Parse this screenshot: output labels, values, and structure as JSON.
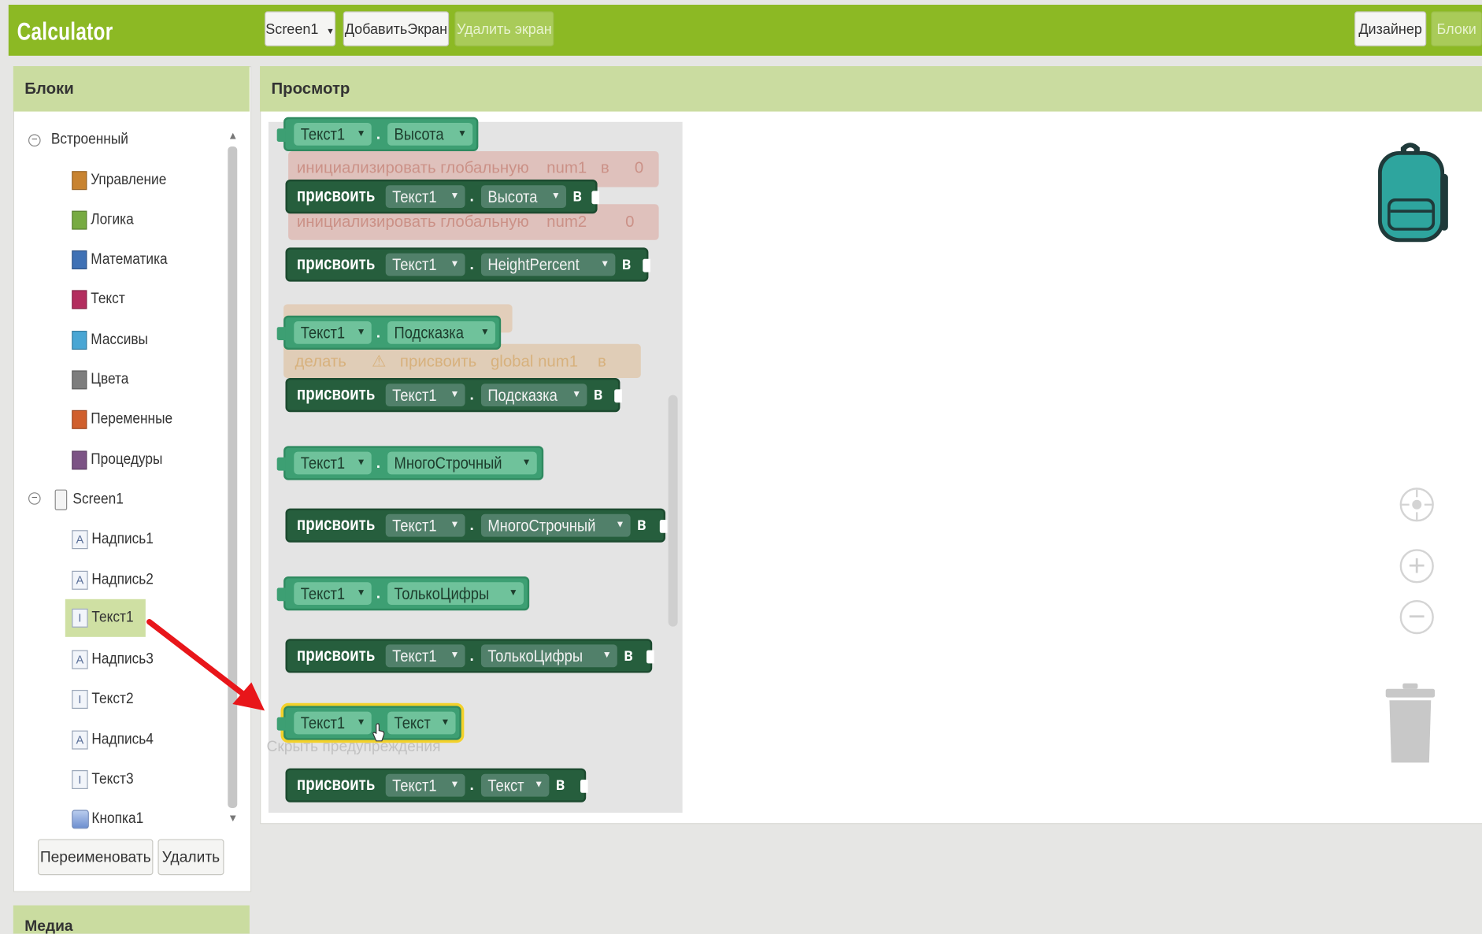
{
  "app": {
    "title": "Calculator"
  },
  "toolbar": {
    "screen_select": "Screen1",
    "add_screen": "ДобавитьЭкран",
    "remove_screen": "Удалить экран",
    "designer": "Дизайнер",
    "blocks": "Блоки"
  },
  "blocks_panel": {
    "header": "Блоки",
    "builtin_label": "Встроенный",
    "builtin_items": [
      {
        "label": "Управление",
        "color": "#c88330"
      },
      {
        "label": "Логика",
        "color": "#77ab41"
      },
      {
        "label": "Математика",
        "color": "#3f71b5"
      },
      {
        "label": "Текст",
        "color": "#b32d5e"
      },
      {
        "label": "Массивы",
        "color": "#49a6d4"
      },
      {
        "label": "Цвета",
        "color": "#7d7d7d"
      },
      {
        "label": "Переменные",
        "color": "#d05f2d"
      },
      {
        "label": "Процедуры",
        "color": "#7c5385"
      }
    ],
    "screen_label": "Screen1",
    "components": [
      {
        "label": "Надпись1",
        "icon": "label-icon"
      },
      {
        "label": "Надпись2",
        "icon": "label-icon"
      },
      {
        "label": "Текст1",
        "icon": "textbox-icon",
        "selected": true
      },
      {
        "label": "Надпись3",
        "icon": "label-icon"
      },
      {
        "label": "Текст2",
        "icon": "textbox-icon"
      },
      {
        "label": "Надпись4",
        "icon": "label-icon"
      },
      {
        "label": "Текст3",
        "icon": "textbox-icon"
      },
      {
        "label": "Кнопка1",
        "icon": "button-icon"
      }
    ],
    "rename_button": "Переименовать",
    "delete_button": "Удалить"
  },
  "media": {
    "header": "Медиа"
  },
  "viewer": {
    "header": "Просмотр"
  },
  "blocks_flyout": {
    "component": "Текст1",
    "set_keyword": "присвоить",
    "to_keyword": "в",
    "rows": [
      {
        "prop": "Высота"
      },
      {
        "prop": "HeightPercent"
      },
      {
        "prop": "Подсказка"
      },
      {
        "prop": "МногоСтрочный"
      },
      {
        "prop": "ТолькоЦифры"
      },
      {
        "prop": "Текст"
      }
    ],
    "ghost_blocks": {
      "init1": "инициализировать глобальную",
      "init1_var": "num1",
      "init1_to": "в",
      "init1_value": "0",
      "init2": "инициализировать глобальную",
      "init2_var": "num2",
      "init2_value": "0",
      "do_label": "делать",
      "do_set": "присвоить",
      "do_var": "global num1",
      "do_to": "в"
    },
    "hide_warnings": "Скрыть предупреждения"
  },
  "colors": {
    "topbar": "#8cb924",
    "panel_header": "#cadca0",
    "getter_block": "#3d9f73",
    "setter_block": "#265e3d",
    "selection": "#f3d12a",
    "arrow": "#e8161a"
  }
}
